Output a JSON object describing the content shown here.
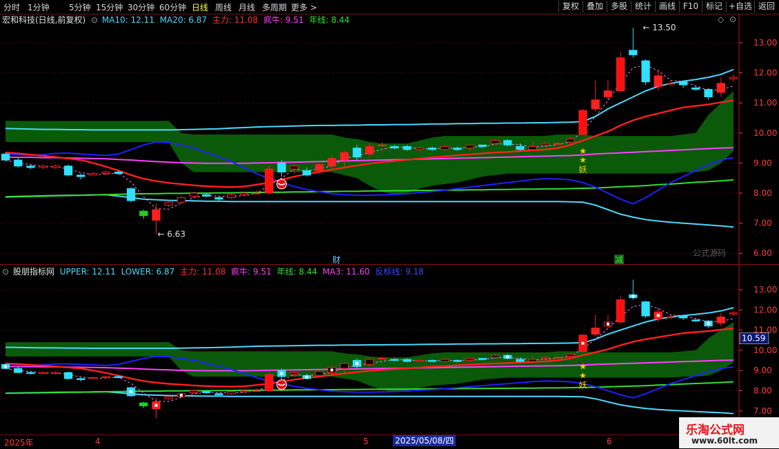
{
  "toolbar": {
    "periods": [
      "分时",
      "1分钟",
      "5分钟",
      "15分钟",
      "30分钟",
      "60分钟",
      "日线",
      "周线",
      "月线",
      "多周期",
      "更多 >"
    ],
    "active_period": "日线",
    "right_buttons": [
      "复权",
      "叠加",
      "多股",
      "统计",
      "画线",
      "F10",
      "标记",
      "+自选",
      "返回"
    ]
  },
  "top_panel": {
    "stock_title": "宏和科技(日线,前复权)",
    "legend": [
      {
        "text": "MA10: 12.11",
        "color": "#4fd8ff"
      },
      {
        "text": "MA20: 6.87",
        "color": "#4fd8ff"
      },
      {
        "text": "主力: 11.08",
        "color": "#ff3030"
      },
      {
        "text": "疯牛: 9.51",
        "color": "#ff40ff"
      },
      {
        "text": "年线: 8.44",
        "color": "#30e030"
      }
    ],
    "price_ticks": [
      "13.00",
      "12.00",
      "11.00",
      "10.00",
      "9.00",
      "8.00",
      "7.00",
      "6.00"
    ],
    "high_label": "13.50",
    "low_label": "6.63",
    "event_markers": [
      {
        "text": "财",
        "color": "#5fd0ff"
      },
      {
        "text": "减",
        "color": "#30e030"
      }
    ],
    "signal_star": "★",
    "signal_text": "妖",
    "source_label": "公式源码"
  },
  "bottom_panel": {
    "title": "股朋指标网",
    "legend": [
      {
        "text": "UPPER: 12.11",
        "color": "#4fd8ff"
      },
      {
        "text": "LOWER: 6.87",
        "color": "#4fd8ff"
      },
      {
        "text": "主力: 11.08",
        "color": "#ff3030"
      },
      {
        "text": "疯牛: 9.51",
        "color": "#ff40ff"
      },
      {
        "text": "年线: 8.44",
        "color": "#30e030"
      },
      {
        "text": "MA3: 11.60",
        "color": "#ff40ff"
      },
      {
        "text": "反标线: 9.18",
        "color": "#4444ff"
      }
    ],
    "price_ticks": [
      "13.00",
      "12.00",
      "11.00",
      "10.00",
      "9.00",
      "8.00",
      "7.00"
    ],
    "current_price": "10.59",
    "signal_star": "★",
    "signal_text": "妖"
  },
  "date_axis": {
    "labels": [
      "2025年",
      "4",
      "5",
      "6"
    ],
    "cursor_date": "2025/05/08/四"
  },
  "watermark": {
    "line1": "乐淘公式网",
    "line2": "www.60lt.com"
  },
  "colors": {
    "up": "#ff2020",
    "down": "#30e0ff",
    "bg": "#000000",
    "band": "#0a5a0a",
    "grid": "#7a1010"
  },
  "chart_data": {
    "type": "candlestick",
    "candles": [
      [
        9.3,
        9.1,
        9.35,
        9.05
      ],
      [
        9.1,
        8.9,
        9.2,
        8.85
      ],
      [
        8.9,
        8.85,
        8.95,
        8.8
      ],
      [
        8.85,
        8.9,
        8.95,
        8.8
      ],
      [
        8.85,
        8.9,
        8.95,
        8.8
      ],
      [
        8.9,
        8.6,
        8.95,
        8.55
      ],
      [
        8.6,
        8.55,
        8.65,
        8.45
      ],
      [
        8.6,
        8.65,
        8.7,
        8.6
      ],
      [
        8.65,
        8.7,
        8.75,
        8.6
      ],
      [
        8.7,
        8.65,
        8.75,
        8.6
      ],
      [
        8.15,
        7.75,
        8.2,
        7.7
      ],
      [
        7.4,
        7.25,
        7.45,
        7.15
      ],
      [
        7.1,
        7.45,
        7.65,
        6.63
      ],
      [
        7.6,
        7.7,
        7.75,
        7.55
      ],
      [
        7.7,
        7.85,
        7.9,
        7.65
      ],
      [
        7.9,
        8.0,
        8.05,
        7.85
      ],
      [
        7.95,
        7.9,
        8.0,
        7.85
      ],
      [
        7.85,
        7.8,
        7.9,
        7.7
      ],
      [
        7.85,
        7.95,
        8.0,
        7.8
      ],
      [
        7.95,
        8.0,
        8.05,
        7.9
      ],
      [
        8.0,
        8.0,
        8.1,
        7.95
      ],
      [
        8.0,
        8.8,
        8.9,
        7.95
      ],
      [
        9.0,
        8.7,
        9.1,
        8.55
      ],
      [
        8.8,
        8.9,
        8.95,
        8.65
      ],
      [
        8.75,
        8.6,
        8.85,
        8.55
      ],
      [
        8.75,
        8.95,
        9.0,
        8.7
      ],
      [
        8.9,
        9.15,
        9.25,
        8.8
      ],
      [
        9.1,
        9.35,
        9.4,
        8.85
      ],
      [
        9.5,
        9.2,
        9.6,
        9.1
      ],
      [
        9.3,
        9.55,
        9.65,
        9.2
      ],
      [
        9.6,
        9.6,
        9.7,
        9.55
      ],
      [
        9.55,
        9.5,
        9.6,
        9.45
      ],
      [
        9.55,
        9.45,
        9.6,
        9.4
      ],
      [
        9.45,
        9.5,
        9.55,
        9.4
      ],
      [
        9.5,
        9.45,
        9.55,
        9.4
      ],
      [
        9.45,
        9.55,
        9.6,
        9.4
      ],
      [
        9.5,
        9.45,
        9.55,
        9.4
      ],
      [
        9.5,
        9.6,
        9.6,
        9.4
      ],
      [
        9.6,
        9.55,
        9.6,
        9.5
      ],
      [
        9.65,
        9.75,
        9.8,
        9.6
      ],
      [
        9.75,
        9.6,
        9.8,
        9.55
      ],
      [
        9.55,
        9.45,
        9.65,
        9.4
      ],
      [
        9.45,
        9.55,
        9.7,
        9.4
      ],
      [
        9.6,
        9.65,
        9.7,
        9.55
      ],
      [
        9.65,
        9.65,
        9.7,
        9.6
      ],
      [
        9.7,
        9.8,
        9.85,
        9.65
      ],
      [
        9.95,
        10.75,
        10.8,
        9.95
      ],
      [
        10.8,
        11.1,
        11.75,
        10.7
      ],
      [
        11.2,
        11.4,
        11.75,
        11.1
      ],
      [
        11.4,
        12.5,
        12.7,
        11.35
      ],
      [
        12.75,
        12.6,
        13.5,
        12.5
      ],
      [
        12.4,
        11.7,
        12.45,
        11.6
      ],
      [
        11.55,
        11.9,
        12.1,
        11.4
      ],
      [
        11.65,
        11.65,
        11.75,
        11.55
      ],
      [
        11.7,
        11.6,
        11.75,
        11.5
      ],
      [
        11.5,
        11.45,
        11.55,
        11.4
      ],
      [
        11.45,
        11.2,
        11.5,
        11.1
      ],
      [
        11.35,
        11.65,
        11.85,
        11.2
      ],
      [
        11.8,
        11.85,
        11.95,
        11.7
      ]
    ],
    "ma_upper": [
      9.27,
      9.25,
      9.24,
      9.23,
      9.23,
      9.22,
      9.22,
      9.21,
      9.21,
      9.2,
      9.2,
      9.2,
      9.2,
      9.2,
      9.2,
      9.21,
      9.21,
      9.22,
      9.22,
      9.23,
      9.24,
      9.26,
      9.28,
      9.3,
      9.31,
      9.32,
      9.33,
      9.34,
      9.35,
      9.36,
      9.37,
      9.38,
      9.39,
      9.4,
      9.41,
      9.42,
      9.43,
      9.44,
      9.45,
      9.46,
      9.47,
      9.48,
      9.49,
      9.5,
      9.52,
      9.55,
      9.65,
      9.85,
      10.05,
      10.3,
      10.55,
      10.75,
      10.95,
      11.1,
      11.2,
      11.3,
      11.4,
      11.5,
      11.6
    ],
    "upper": [
      10.15,
      10.14,
      10.13,
      10.12,
      10.12,
      10.11,
      10.11,
      10.1,
      10.1,
      10.1,
      10.1,
      10.1,
      10.1,
      10.1,
      10.11,
      10.12,
      10.13,
      10.14,
      10.16,
      10.18,
      10.2,
      10.21,
      10.22,
      10.23,
      10.24,
      10.25,
      10.25,
      10.26,
      10.26,
      10.27,
      10.27,
      10.28,
      10.28,
      10.29,
      10.3,
      10.3,
      10.31,
      10.31,
      10.32,
      10.32,
      10.33,
      10.33,
      10.34,
      10.34,
      10.35,
      10.36,
      10.38,
      10.55,
      10.8,
      11.0,
      11.2,
      11.4,
      11.55,
      11.65,
      11.72,
      11.78,
      11.85,
      11.95,
      12.11
    ],
    "lower": [
      7.88,
      7.89,
      7.9,
      7.91,
      7.92,
      7.93,
      7.93,
      7.94,
      7.95,
      7.9,
      7.85,
      7.8,
      7.78,
      7.76,
      7.75,
      7.74,
      7.73,
      7.73,
      7.72,
      7.72,
      7.72,
      7.72,
      7.72,
      7.72,
      7.72,
      7.72,
      7.72,
      7.72,
      7.72,
      7.72,
      7.72,
      7.72,
      7.72,
      7.72,
      7.72,
      7.72,
      7.72,
      7.72,
      7.72,
      7.72,
      7.72,
      7.72,
      7.72,
      7.72,
      7.72,
      7.71,
      7.7,
      7.6,
      7.45,
      7.3,
      7.2,
      7.12,
      7.07,
      7.03,
      7.0,
      6.97,
      6.94,
      6.91,
      6.87
    ],
    "zhuli": [
      9.35,
      9.32,
      9.28,
      9.24,
      9.2,
      9.15,
      9.1,
      9.0,
      8.88,
      8.75,
      8.6,
      8.48,
      8.4,
      8.34,
      8.3,
      8.26,
      8.23,
      8.21,
      8.2,
      8.22,
      8.28,
      8.35,
      8.45,
      8.55,
      8.63,
      8.7,
      8.78,
      8.85,
      8.92,
      8.98,
      9.03,
      9.07,
      9.11,
      9.15,
      9.19,
      9.22,
      9.26,
      9.29,
      9.32,
      9.35,
      9.37,
      9.4,
      9.42,
      9.45,
      9.5,
      9.6,
      9.75,
      9.9,
      10.05,
      10.25,
      10.42,
      10.55,
      10.65,
      10.75,
      10.85,
      10.9,
      10.95,
      11.02,
      11.08
    ],
    "fengniu": [
      9.2,
      9.19,
      9.19,
      9.18,
      9.18,
      9.17,
      9.16,
      9.15,
      9.14,
      9.12,
      9.1,
      9.07,
      9.05,
      9.03,
      9.01,
      9.0,
      8.99,
      8.99,
      8.99,
      8.99,
      9.0,
      9.01,
      9.02,
      9.03,
      9.04,
      9.05,
      9.06,
      9.07,
      9.08,
      9.09,
      9.1,
      9.11,
      9.12,
      9.13,
      9.14,
      9.15,
      9.16,
      9.17,
      9.18,
      9.19,
      9.2,
      9.21,
      9.22,
      9.23,
      9.24,
      9.25,
      9.27,
      9.3,
      9.32,
      9.34,
      9.36,
      9.38,
      9.4,
      9.42,
      9.44,
      9.46,
      9.48,
      9.5,
      9.51
    ],
    "nianxian": [
      7.87,
      7.88,
      7.89,
      7.9,
      7.91,
      7.92,
      7.93,
      7.94,
      7.95,
      7.96,
      7.97,
      7.98,
      7.98,
      7.99,
      7.99,
      8.0,
      8.0,
      8.01,
      8.01,
      8.02,
      8.02,
      8.03,
      8.03,
      8.04,
      8.04,
      8.05,
      8.05,
      8.06,
      8.06,
      8.07,
      8.07,
      8.08,
      8.08,
      8.09,
      8.09,
      8.1,
      8.1,
      8.11,
      8.11,
      8.12,
      8.12,
      8.13,
      8.13,
      8.14,
      8.14,
      8.15,
      8.16,
      8.17,
      8.19,
      8.21,
      8.23,
      8.25,
      8.28,
      8.3,
      8.33,
      8.36,
      8.38,
      8.41,
      8.44
    ],
    "blue": [
      9.3,
      9.28,
      9.25,
      9.28,
      9.32,
      9.33,
      9.3,
      9.28,
      9.25,
      9.3,
      9.45,
      9.6,
      9.7,
      9.68,
      9.6,
      9.5,
      9.35,
      9.2,
      9.05,
      8.85,
      8.65,
      8.48,
      8.35,
      8.22,
      8.12,
      8.05,
      7.98,
      7.95,
      7.93,
      7.93,
      7.94,
      7.96,
      7.98,
      8.02,
      8.05,
      8.1,
      8.15,
      8.2,
      8.25,
      8.3,
      8.35,
      8.4,
      8.45,
      8.48,
      8.47,
      8.44,
      8.35,
      8.2,
      8.0,
      7.8,
      7.65,
      7.85,
      8.1,
      8.35,
      8.55,
      8.75,
      8.95,
      9.1,
      9.18
    ],
    "band_top": [
      10.4,
      10.4,
      10.4,
      10.4,
      10.4,
      10.4,
      10.4,
      10.4,
      10.4,
      10.4,
      10.4,
      10.4,
      10.4,
      10.4,
      10.0,
      9.95,
      9.95,
      9.95,
      9.95,
      9.95,
      9.95,
      9.95,
      9.95,
      9.95,
      9.95,
      9.95,
      9.95,
      9.85,
      9.8,
      9.7,
      9.65,
      9.65,
      9.65,
      9.75,
      9.85,
      9.9,
      9.9,
      9.9,
      9.9,
      9.9,
      9.9,
      9.9,
      9.9,
      9.9,
      9.95,
      9.95,
      9.95,
      9.9,
      9.9,
      9.9,
      9.9,
      9.9,
      9.9,
      9.9,
      9.95,
      10.0,
      10.6,
      11.0,
      11.4
    ],
    "band_bottom": [
      9.7,
      9.7,
      9.7,
      9.7,
      9.7,
      9.7,
      9.7,
      9.7,
      9.7,
      9.7,
      9.7,
      9.7,
      9.7,
      9.7,
      9.0,
      8.7,
      8.7,
      8.7,
      8.7,
      8.7,
      8.7,
      8.7,
      8.7,
      8.7,
      8.7,
      8.7,
      8.7,
      8.6,
      8.5,
      8.25,
      8.05,
      7.95,
      8.0,
      8.15,
      8.25,
      8.3,
      8.35,
      8.45,
      8.55,
      8.6,
      8.65,
      8.65,
      8.65,
      8.65,
      8.65,
      8.65,
      8.65,
      8.65,
      8.65,
      8.65,
      8.65,
      8.65,
      8.65,
      8.65,
      8.7,
      8.7,
      8.75,
      9.0,
      9.4
    ]
  }
}
